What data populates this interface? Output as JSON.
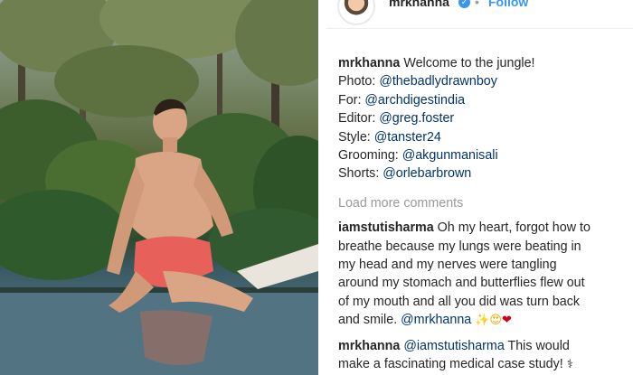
{
  "header": {
    "username": "mrkhanna",
    "follow_label": "Follow",
    "separator": "•"
  },
  "caption": {
    "username": "mrkhanna",
    "text": "Welcome to the jungle!",
    "credits": [
      {
        "label": "Photo: ",
        "mention": "@thebadlydrawnboy"
      },
      {
        "label": "For: ",
        "mention": "@archdigestindia"
      },
      {
        "label": "Editor: ",
        "mention": "@greg.foster"
      },
      {
        "label": "Style: ",
        "mention": "@tanster24"
      },
      {
        "label": "Grooming: ",
        "mention": "@akgunmanisali"
      },
      {
        "label": "Shorts: ",
        "mention": "@orlebarbrown"
      }
    ]
  },
  "load_more_label": "Load more comments",
  "comments": [
    {
      "username": "iamstutisharma",
      "lines": [
        "Oh my heart, forgot how to",
        "breathe because my lungs were beating in",
        "my head and my nerves were tangling",
        "around my stomach and butterflies flew out",
        "of my mouth and all you did was turn back",
        "and smile. "
      ],
      "mention": "@mrkhanna",
      "emoji": [
        "✨",
        "😍",
        "❤"
      ]
    },
    {
      "username": "mrkhanna",
      "mention": "@iamstutisharma",
      "lines": [
        " This would",
        "make a fascinating medical case study! "
      ],
      "emoji": [
        "⚕"
      ]
    }
  ],
  "colors": {
    "link": "#003569",
    "muted": "#999999",
    "follow": "#3897f0",
    "heart": "#d0021b",
    "shorts": "#e8605a",
    "skin": "#d9a585"
  },
  "icons": {
    "verified": "verified-badge-icon",
    "avatar": "profile-avatar"
  }
}
